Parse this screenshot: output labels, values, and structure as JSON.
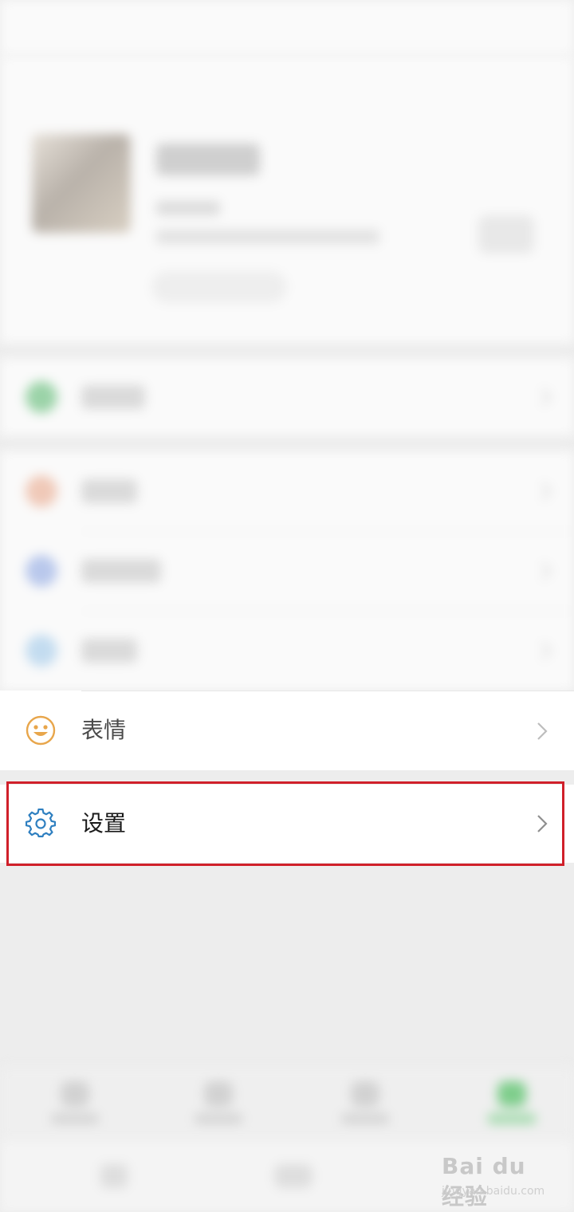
{
  "menu": {
    "emoji": {
      "label": "表情",
      "icon": "smiley-icon",
      "icon_color": "#E8A64B"
    },
    "settings": {
      "label": "设置",
      "icon": "gear-icon",
      "icon_color": "#2E7FC0"
    }
  },
  "highlight": {
    "color": "#D0202A"
  },
  "watermark": {
    "brand": "Bai du 经验",
    "url": "jingyan.baidu.com"
  }
}
